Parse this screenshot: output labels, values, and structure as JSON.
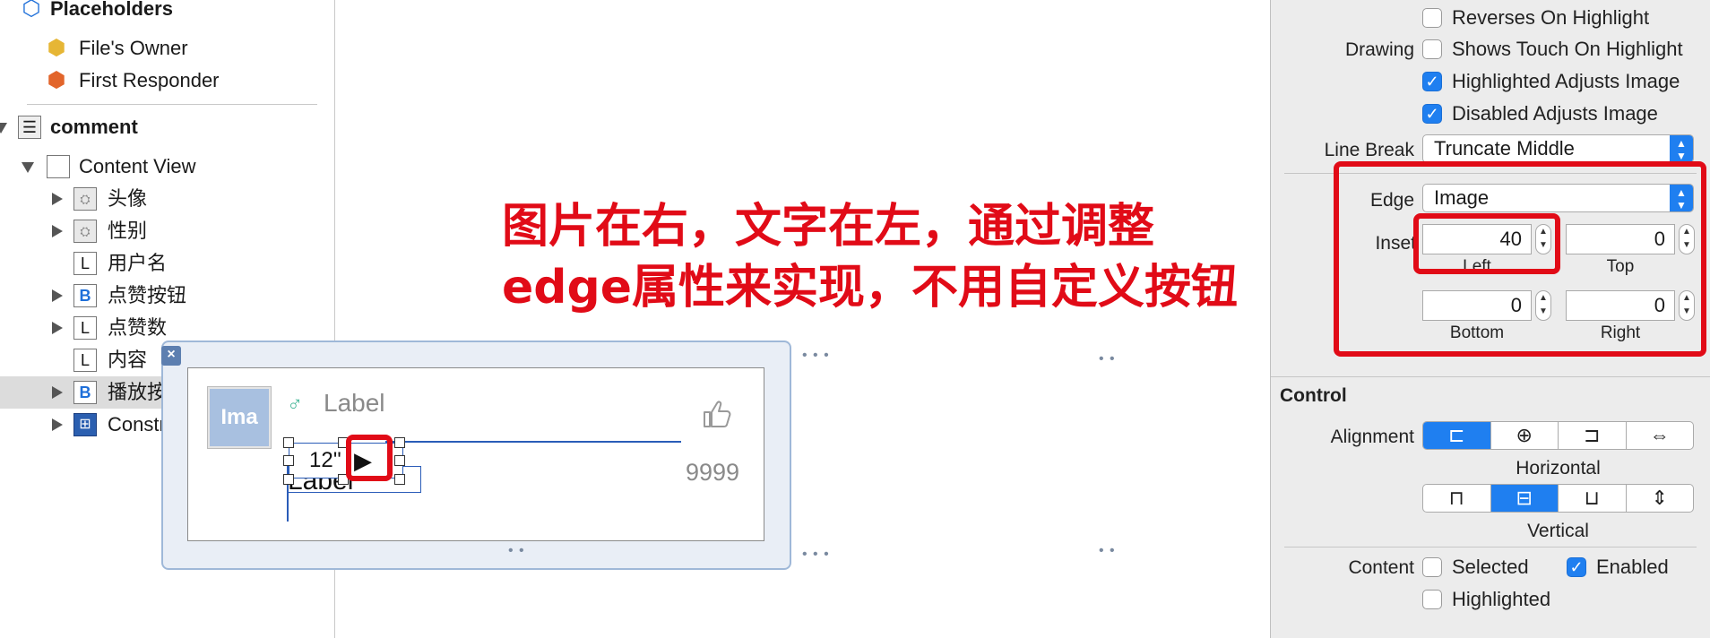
{
  "outline": {
    "placeholders": "Placeholders",
    "files_owner": "File's Owner",
    "first_responder": "First Responder",
    "comment": "comment",
    "content_view": "Content View",
    "items": [
      {
        "label": "头像",
        "type": "image"
      },
      {
        "label": "性别",
        "type": "image"
      },
      {
        "label": "用户名",
        "type": "label"
      },
      {
        "label": "点赞按钮",
        "type": "button"
      },
      {
        "label": "点赞数",
        "type": "label"
      },
      {
        "label": "内容",
        "type": "label"
      },
      {
        "label": "播放按钮",
        "type": "button"
      }
    ],
    "constraints": "Constraints",
    "icon_letters": {
      "label": "L",
      "button": "B"
    }
  },
  "canvas": {
    "avatar_text": "Ima",
    "gender_symbol": "♂",
    "username": "Label",
    "likes_count": "9999",
    "comment_label": "Label",
    "duration_text": "12''",
    "play_icon": "▶",
    "annotation_line1": "图片在右，文字在左，通过调整",
    "annotation_line2": "edge属性来实现，不用自定义按钮"
  },
  "inspector": {
    "reverses_on_highlight": {
      "label": "Reverses On Highlight",
      "checked": false
    },
    "drawing_label": "Drawing",
    "shows_touch_on_highlight": {
      "label": "Shows Touch On Highlight",
      "checked": false
    },
    "highlighted_adjusts_image": {
      "label": "Highlighted Adjusts Image",
      "checked": true
    },
    "disabled_adjusts_image": {
      "label": "Disabled Adjusts Image",
      "checked": true
    },
    "line_break_label": "Line Break",
    "line_break_value": "Truncate Middle",
    "edge_label": "Edge",
    "edge_value": "Image",
    "inset_label": "Inset",
    "inset_left": "40",
    "inset_left_label": "Left",
    "inset_top": "0",
    "inset_top_label": "Top",
    "inset_bottom": "0",
    "inset_bottom_label": "Bottom",
    "inset_right": "0",
    "inset_right_label": "Right",
    "control_title": "Control",
    "alignment_label": "Alignment",
    "horizontal_label": "Horizontal",
    "vertical_label": "Vertical",
    "horizontal_selected_index": 0,
    "vertical_selected_index": 1,
    "content_label": "Content",
    "selected": {
      "label": "Selected",
      "checked": false
    },
    "enabled": {
      "label": "Enabled",
      "checked": true
    },
    "highlighted": {
      "label": "Highlighted",
      "checked": false
    }
  },
  "colors": {
    "accent": "#1f7ff0",
    "annotation_red": "#e10b17",
    "selection_gray": "#dcdcdc"
  }
}
